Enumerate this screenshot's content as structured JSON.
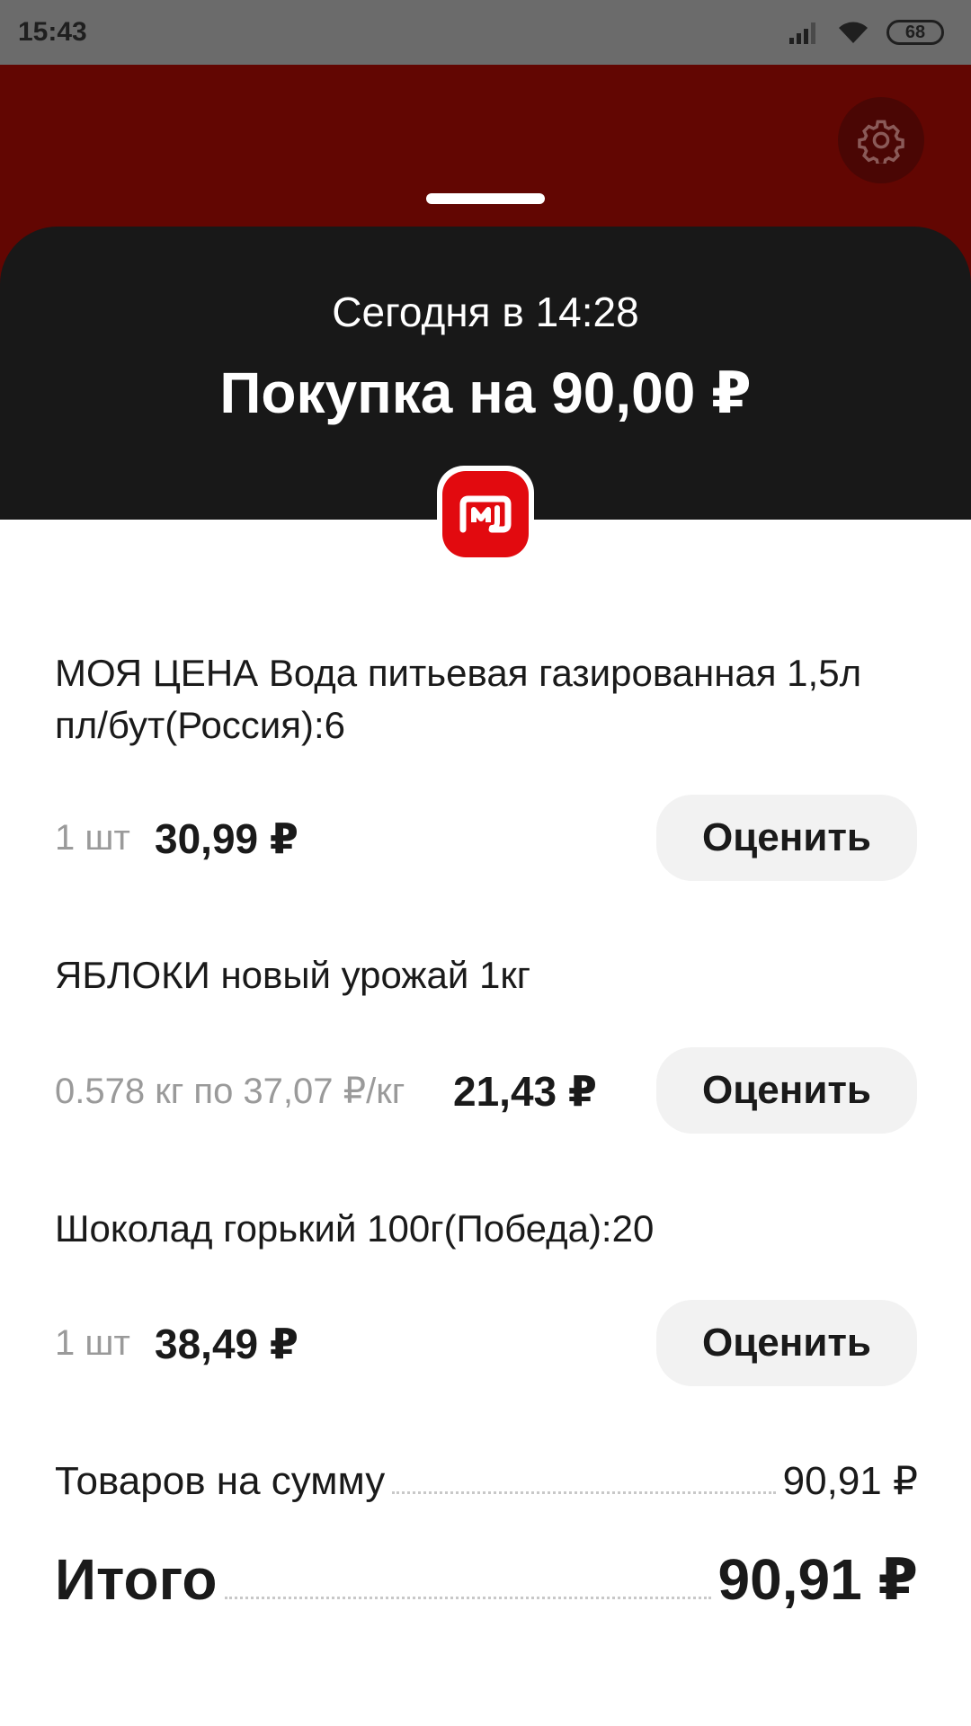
{
  "status_bar": {
    "time": "15:43",
    "battery": "68"
  },
  "colors": {
    "header_bg": "#620602",
    "sheet_bg": "#181818",
    "logo_red": "#e20a0f"
  },
  "receipt": {
    "date": "Сегодня в 14:28",
    "title": "Покупка на 90,00 ₽"
  },
  "items": [
    {
      "name": "МОЯ ЦЕНА Вода питьевая газированная 1,5л пл/бут(Россия):6",
      "qty": "1 шт",
      "price": "30,99 ₽",
      "rate_label": "Оценить"
    },
    {
      "name": "ЯБЛОКИ новый урожай 1кг",
      "qty": "0.578 кг по 37,07 ₽/кг",
      "price": "21,43 ₽",
      "rate_label": "Оценить"
    },
    {
      "name": "Шоколад горький 100г(Победа):20",
      "qty": "1 шт",
      "price": "38,49 ₽",
      "rate_label": "Оценить"
    }
  ],
  "summary": {
    "goods_label": "Товаров на сумму",
    "goods_value": "90,91 ₽",
    "total_label": "Итого",
    "total_value": "90,91 ₽"
  }
}
